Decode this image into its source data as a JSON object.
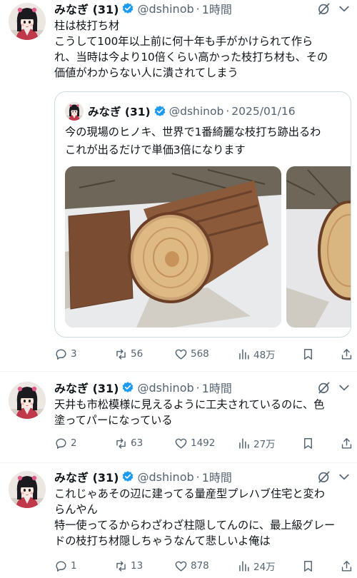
{
  "posts": [
    {
      "author": "みなぎ (31)",
      "handle": "@dshinob",
      "dot": "·",
      "time": "1時間",
      "lines": [
        "柱は枝打ち材",
        "こうして100年以上前に何十年も手がかけられて作ら",
        "れ、当時は今より10倍くらい高かった枝打ち材も、その",
        "価値がわからない人に潰されてしまう"
      ],
      "quote": {
        "author": "みなぎ (31)",
        "handle": "@dshinob",
        "dot": "·",
        "date": "2025/01/16",
        "lines": [
          "今の現場のヒノキ、世界で1番綺麗な枝打ち跡出るわ",
          "これが出るだけで単価3倍になります"
        ]
      },
      "stats": {
        "replies": "3",
        "reposts": "56",
        "likes": "568",
        "views": "48万"
      }
    },
    {
      "author": "みなぎ (31)",
      "handle": "@dshinob",
      "dot": "·",
      "time": "1時間",
      "lines": [
        "天井も市松模様に見えるように工夫されているのに、色",
        "塗ってパーになっている"
      ],
      "stats": {
        "replies": "2",
        "reposts": "63",
        "likes": "1492",
        "views": "27万"
      }
    },
    {
      "author": "みなぎ (31)",
      "handle": "@dshinob",
      "dot": "·",
      "time": "1時間",
      "lines": [
        "これじゃあその辺に建ってる量産型プレハブ住宅と変わ",
        "らんやん",
        "特一使ってるからわざわざ柱隠してんのに、最上級グレー",
        "ドの枝打ち材隠しちゃうなんて悲しいよ俺は"
      ],
      "stats": {
        "replies": "1",
        "reposts": "13",
        "likes": "878",
        "views": "24万"
      }
    }
  ],
  "colors": {
    "verified": "#1d9bf0",
    "secondary": "#536471",
    "border": "#cfd9de"
  },
  "icons": [
    "verified-badge-icon",
    "grok-icon",
    "more-icon",
    "reply-icon",
    "repost-icon",
    "like-icon",
    "views-icon",
    "bookmark-icon",
    "share-icon"
  ]
}
